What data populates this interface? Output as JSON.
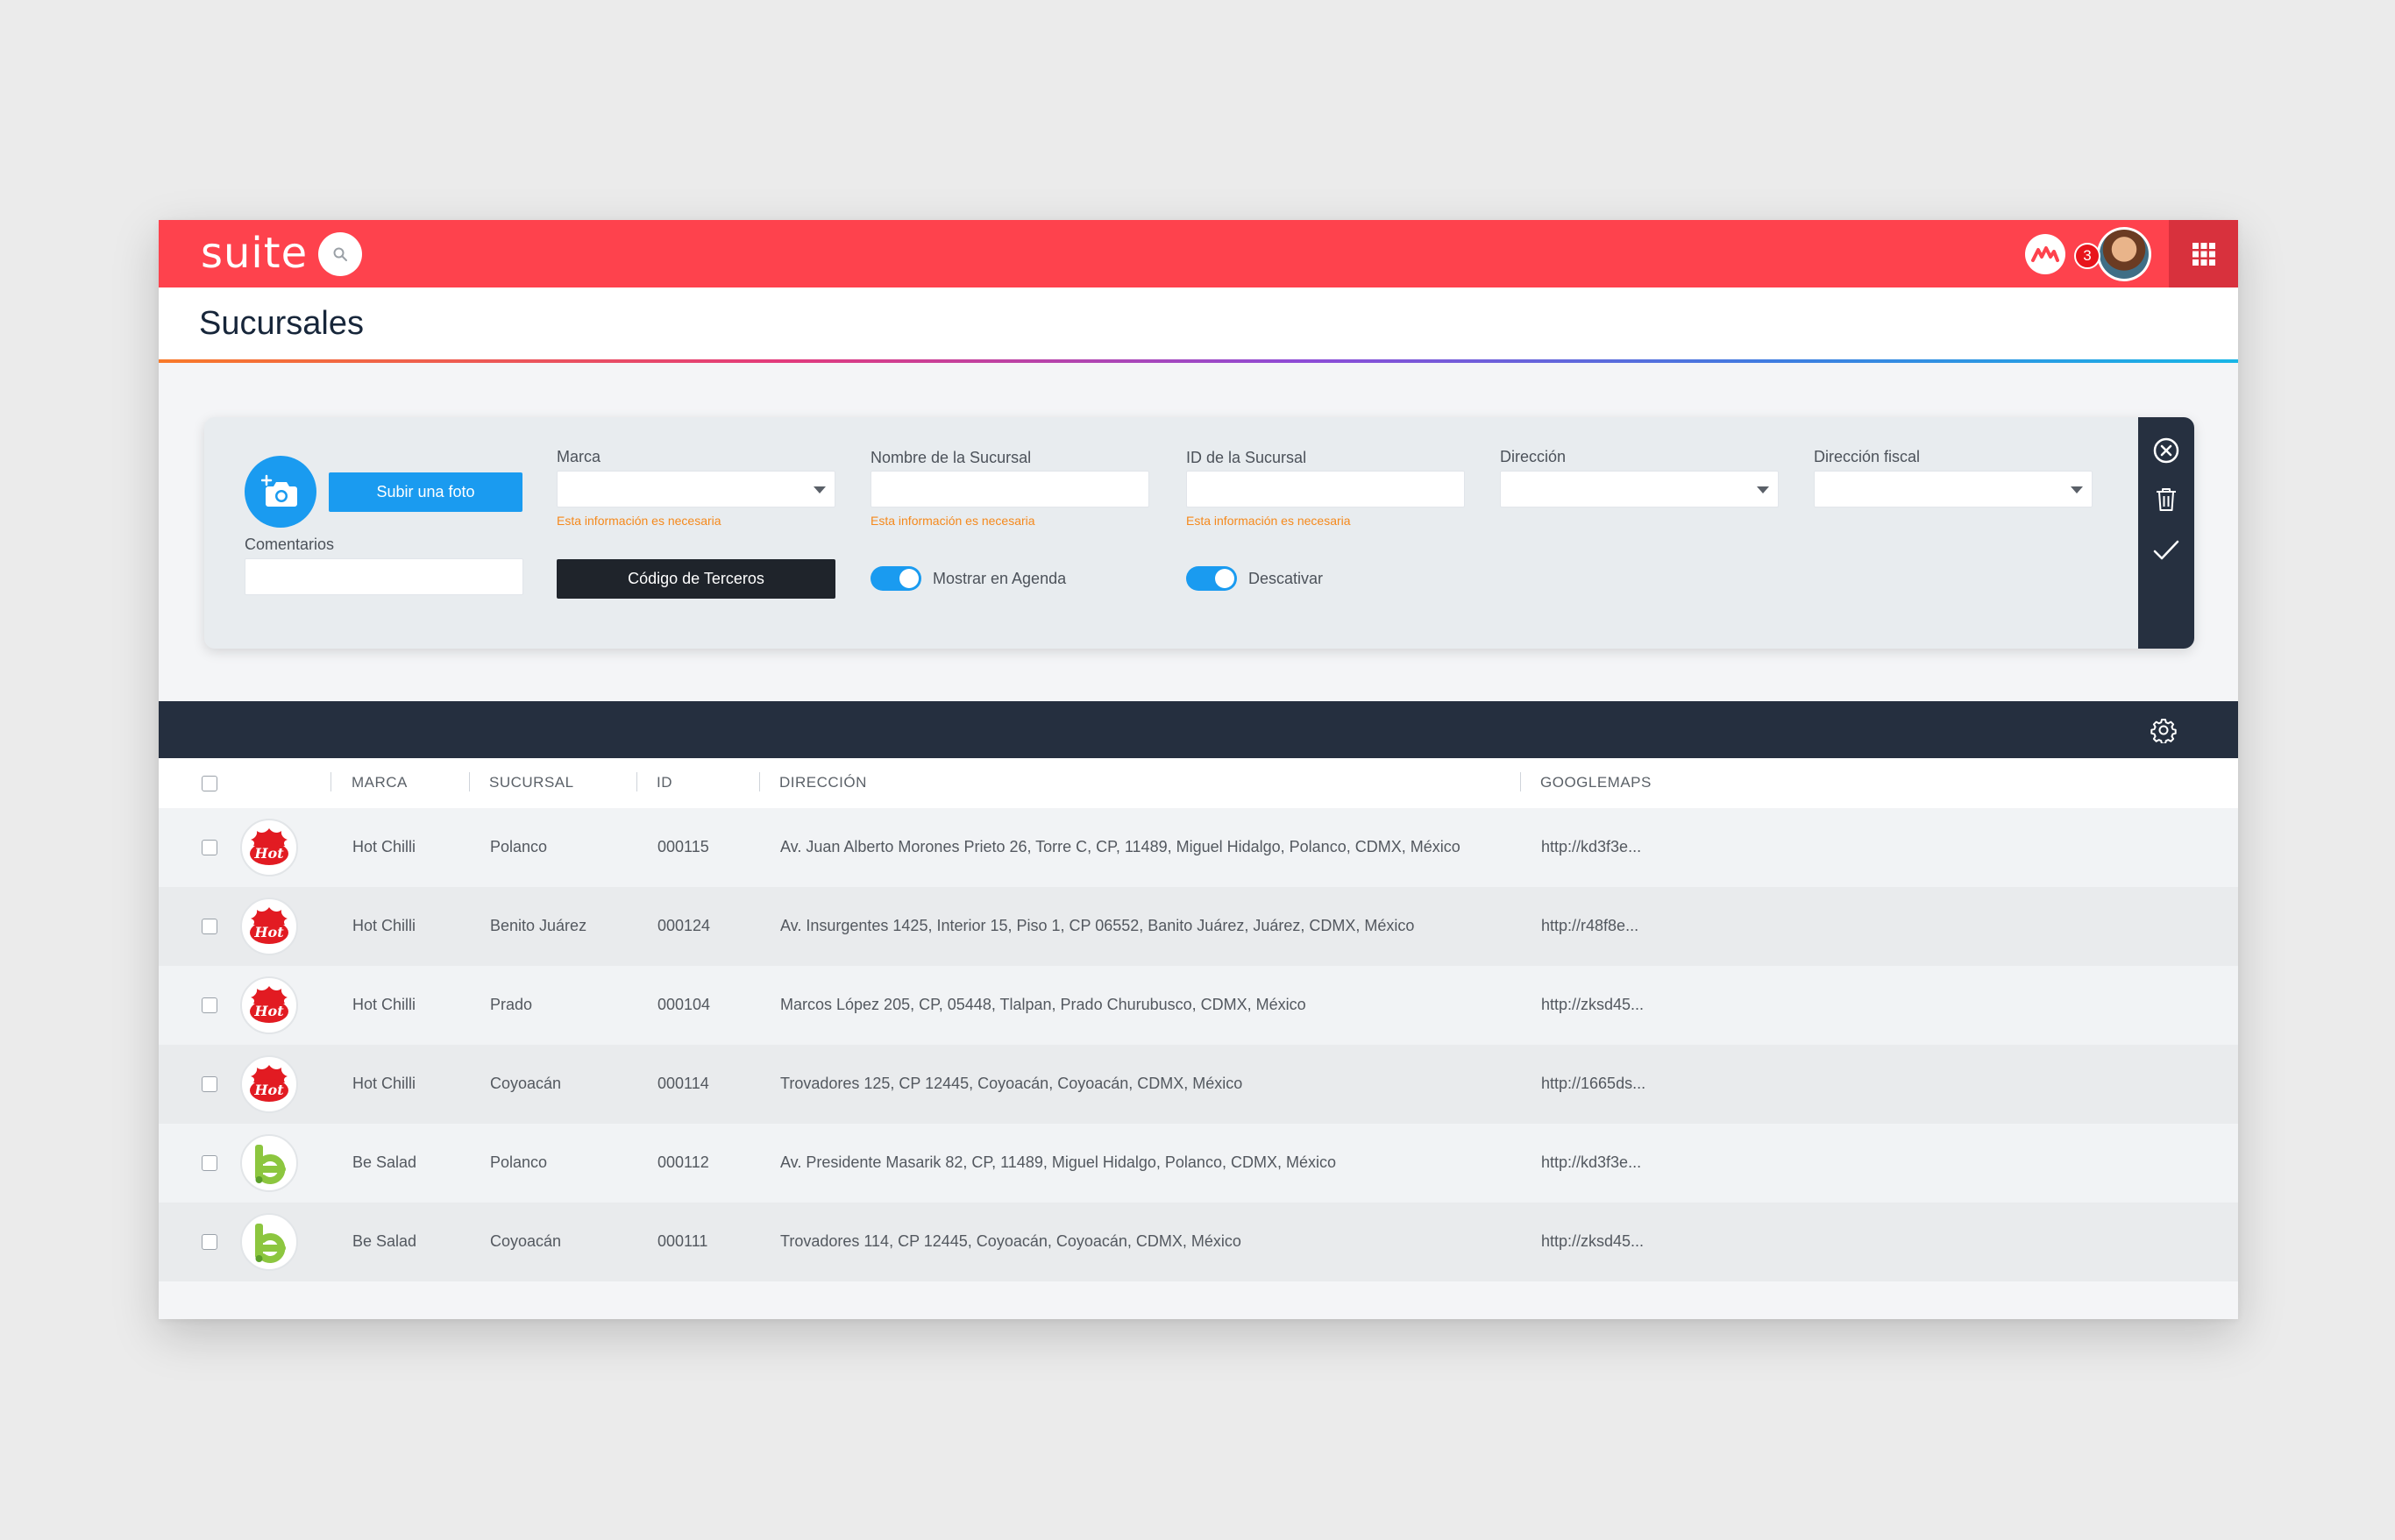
{
  "app": {
    "logo": "suite",
    "notifications_count": "3",
    "page_title": "Sucursales",
    "colors": {
      "topbar": "#fe424d",
      "accent_blue": "#1a9bf0",
      "dark_bar": "#252f3f",
      "error": "#f5891c"
    }
  },
  "icons": {
    "search": "search-icon",
    "brand": "brand-logo-icon",
    "apps": "grid-icon",
    "camera": "camera-add-icon",
    "close": "close-circle-icon",
    "delete": "trash-icon",
    "confirm": "check-icon",
    "settings": "gear-icon"
  },
  "form": {
    "upload_label": "Subir una foto",
    "comentarios_label": "Comentarios",
    "comentarios_value": "",
    "marca_label": "Marca",
    "marca_value": "",
    "marca_error": "Esta información es necesaria",
    "nombre_label": "Nombre de la Sucursal",
    "nombre_value": "",
    "nombre_error": "Esta información es necesaria",
    "id_label": "ID de la Sucursal",
    "id_value": "",
    "id_error": "Esta información es necesaria",
    "direccion_label": "Dirección",
    "direccion_value": "",
    "direccion_fiscal_label": "Dirección fiscal",
    "direccion_fiscal_value": "",
    "terceros_label": "Código de Terceros",
    "agenda_label": "Mostrar en Agenda",
    "agenda_on": true,
    "desactivar_label": "Descativar",
    "desactivar_on": true
  },
  "table": {
    "columns": [
      "MARCA",
      "SUCURSAL",
      "ID",
      "DIRECCIÓN",
      "GOOGLEMAPS"
    ],
    "rows": [
      {
        "brand_type": "hot",
        "marca": "Hot Chilli",
        "sucursal": "Polanco",
        "id": "000115",
        "direccion": "Av. Juan Alberto Morones Prieto 26, Torre C, CP, 11489, Miguel Hidalgo, Polanco, CDMX, México",
        "maps": "http://kd3f3e..."
      },
      {
        "brand_type": "hot",
        "marca": "Hot Chilli",
        "sucursal": "Benito Juárez",
        "id": "000124",
        "direccion": "Av. Insurgentes 1425, Interior 15, Piso 1, CP 06552, Banito Juárez, Juárez, CDMX, México",
        "maps": "http://r48f8e..."
      },
      {
        "brand_type": "hot",
        "marca": "Hot Chilli",
        "sucursal": "Prado",
        "id": "000104",
        "direccion": "Marcos López 205, CP, 05448, Tlalpan, Prado Churubusco, CDMX, México",
        "maps": "http://zksd45..."
      },
      {
        "brand_type": "hot",
        "marca": "Hot Chilli",
        "sucursal": "Coyoacán",
        "id": "000114",
        "direccion": "Trovadores 125, CP 12445, Coyoacán, Coyoacán, CDMX, México",
        "maps": "http://1665ds..."
      },
      {
        "brand_type": "salad",
        "marca": "Be Salad",
        "sucursal": "Polanco",
        "id": "000112",
        "direccion": "Av. Presidente Masarik 82, CP, 11489, Miguel Hidalgo, Polanco, CDMX, México",
        "maps": "http://kd3f3e..."
      },
      {
        "brand_type": "salad",
        "marca": "Be Salad",
        "sucursal": "Coyoacán",
        "id": "000111",
        "direccion": "Trovadores 114, CP 12445, Coyoacán, Coyoacán, CDMX, México",
        "maps": "http://zksd45..."
      }
    ]
  }
}
